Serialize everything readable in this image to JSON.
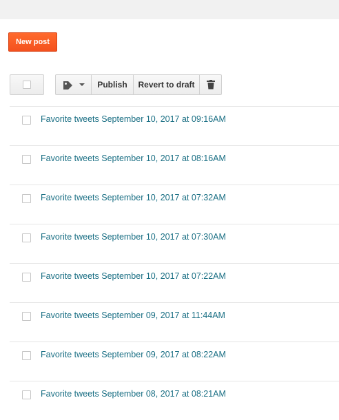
{
  "toolbar": {
    "new_post_label": "New post",
    "publish_label": "Publish",
    "revert_label": "Revert to draft"
  },
  "icons": {
    "label": "tag-icon",
    "dropdown": "caret-down-icon",
    "delete": "trash-icon"
  },
  "colors": {
    "accent": "#ff5722",
    "link": "#1a6f84"
  },
  "posts": [
    {
      "title": "Favorite tweets September 10, 2017 at 09:16AM"
    },
    {
      "title": "Favorite tweets September 10, 2017 at 08:16AM"
    },
    {
      "title": "Favorite tweets September 10, 2017 at 07:32AM"
    },
    {
      "title": "Favorite tweets September 10, 2017 at 07:30AM"
    },
    {
      "title": "Favorite tweets September 10, 2017 at 07:22AM"
    },
    {
      "title": "Favorite tweets September 09, 2017 at 11:44AM"
    },
    {
      "title": "Favorite tweets September 09, 2017 at 08:22AM"
    },
    {
      "title": "Favorite tweets September 08, 2017 at 08:21AM"
    }
  ]
}
